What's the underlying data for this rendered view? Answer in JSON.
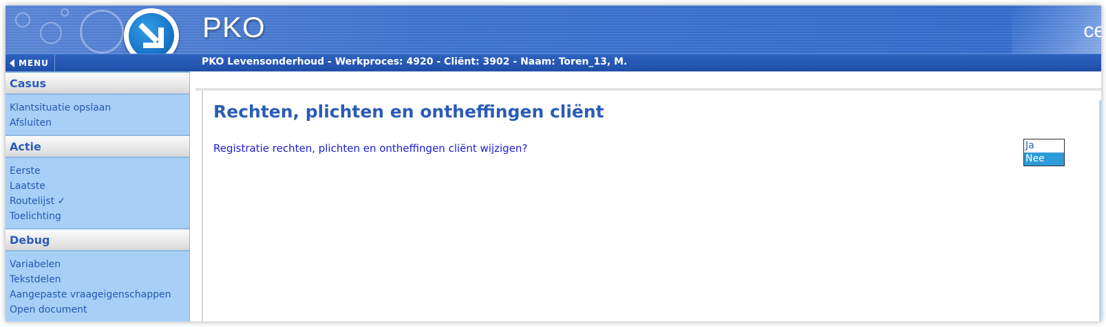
{
  "header": {
    "app_title": "PKO",
    "corner_text": "ce",
    "menu_label": "MENU",
    "info_line": "PKO Levensonderhoud - Werkproces: 4920 - Cliënt: 3902 - Naam: Toren_13, M."
  },
  "sidebar": {
    "sections": [
      {
        "title": "Casus",
        "items": [
          "Klantsituatie opslaan",
          "Afsluiten"
        ]
      },
      {
        "title": "Actie",
        "items": [
          "Eerste",
          "Laatste",
          "Routelijst ✓",
          "Toelichting"
        ]
      },
      {
        "title": "Debug",
        "items": [
          "Variabelen",
          "Tekstdelen",
          "Aangepaste vraageigenschappen",
          "Open document"
        ]
      }
    ]
  },
  "main": {
    "page_title": "Rechten, plichten en ontheffingen cliënt",
    "question": "Registratie rechten, plichten en ontheffingen cliënt wijzigen?",
    "options": [
      "Ja",
      "Nee"
    ],
    "selected_option": "Nee"
  },
  "colors": {
    "header_blue": "#3367c6",
    "sidebar_blue": "#a8cff7",
    "heading_blue": "#2a5cb8",
    "question_text": "#1a1ad8",
    "selection": "#2c9cd8"
  },
  "icons": {
    "logo": "arrow-down-right-icon",
    "menu": "triangle-left-icon"
  }
}
